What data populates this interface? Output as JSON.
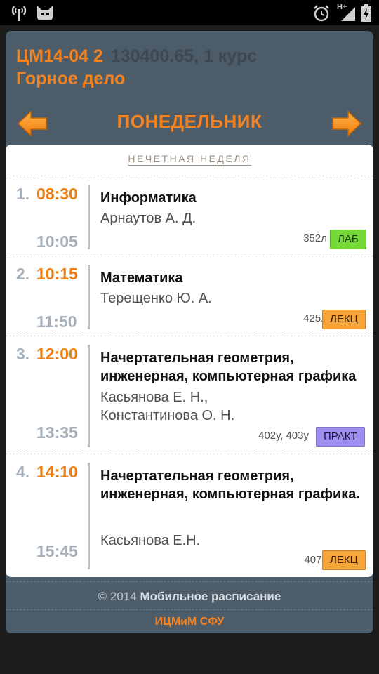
{
  "status_bar": {
    "icons": [
      "signal-wifi-icon",
      "robot-face-icon",
      "alarm-clock-icon",
      "cellular-signal-icon",
      "battery-charging-icon"
    ],
    "network_type": "H+"
  },
  "header": {
    "group_code": "ЦМ14-04 2",
    "group_meta": "130400.65, 1 курс",
    "specialty": "Горное дело",
    "day": "ПОНЕДЕЛЬНИК",
    "accent_color": "#f58220"
  },
  "schedule": {
    "week_label": "НЕЧЕТНАЯ НЕДЕЛЯ",
    "lessons": [
      {
        "number": "1.",
        "start": "08:30",
        "end": "10:05",
        "subject": "Информатика",
        "teacher": "Арнаутов А. Д.",
        "room": "352л",
        "type": "ЛАБ",
        "type_color": "#76d937"
      },
      {
        "number": "2.",
        "start": "10:15",
        "end": "11:50",
        "subject": "Математика",
        "teacher": "Терещенко Ю. А.",
        "room": "425л",
        "type": "ЛЕКЦ",
        "type_color": "#f5a53a"
      },
      {
        "number": "3.",
        "start": "12:00",
        "end": "13:35",
        "subject": "Начертательная геометрия, инженерная, компьютерная графика",
        "teacher": "Касьянова Е. Н., Константинова О. Н.",
        "room": "402у, 403у",
        "type": "ПРАКТ",
        "type_color": "#9f8ff0"
      },
      {
        "number": "4.",
        "start": "14:10",
        "end": "15:45",
        "subject": "Начертательная геометрия, инженерная, компьютерная графика.",
        "teacher": "Касьянова Е.Н.",
        "room": "407у",
        "type": "ЛЕКЦ",
        "type_color": "#f5a53a"
      }
    ]
  },
  "footer": {
    "copyright_prefix": "© 2014",
    "app_name": "Мобильное расписание",
    "organization": "ИЦМиМ СФУ"
  }
}
